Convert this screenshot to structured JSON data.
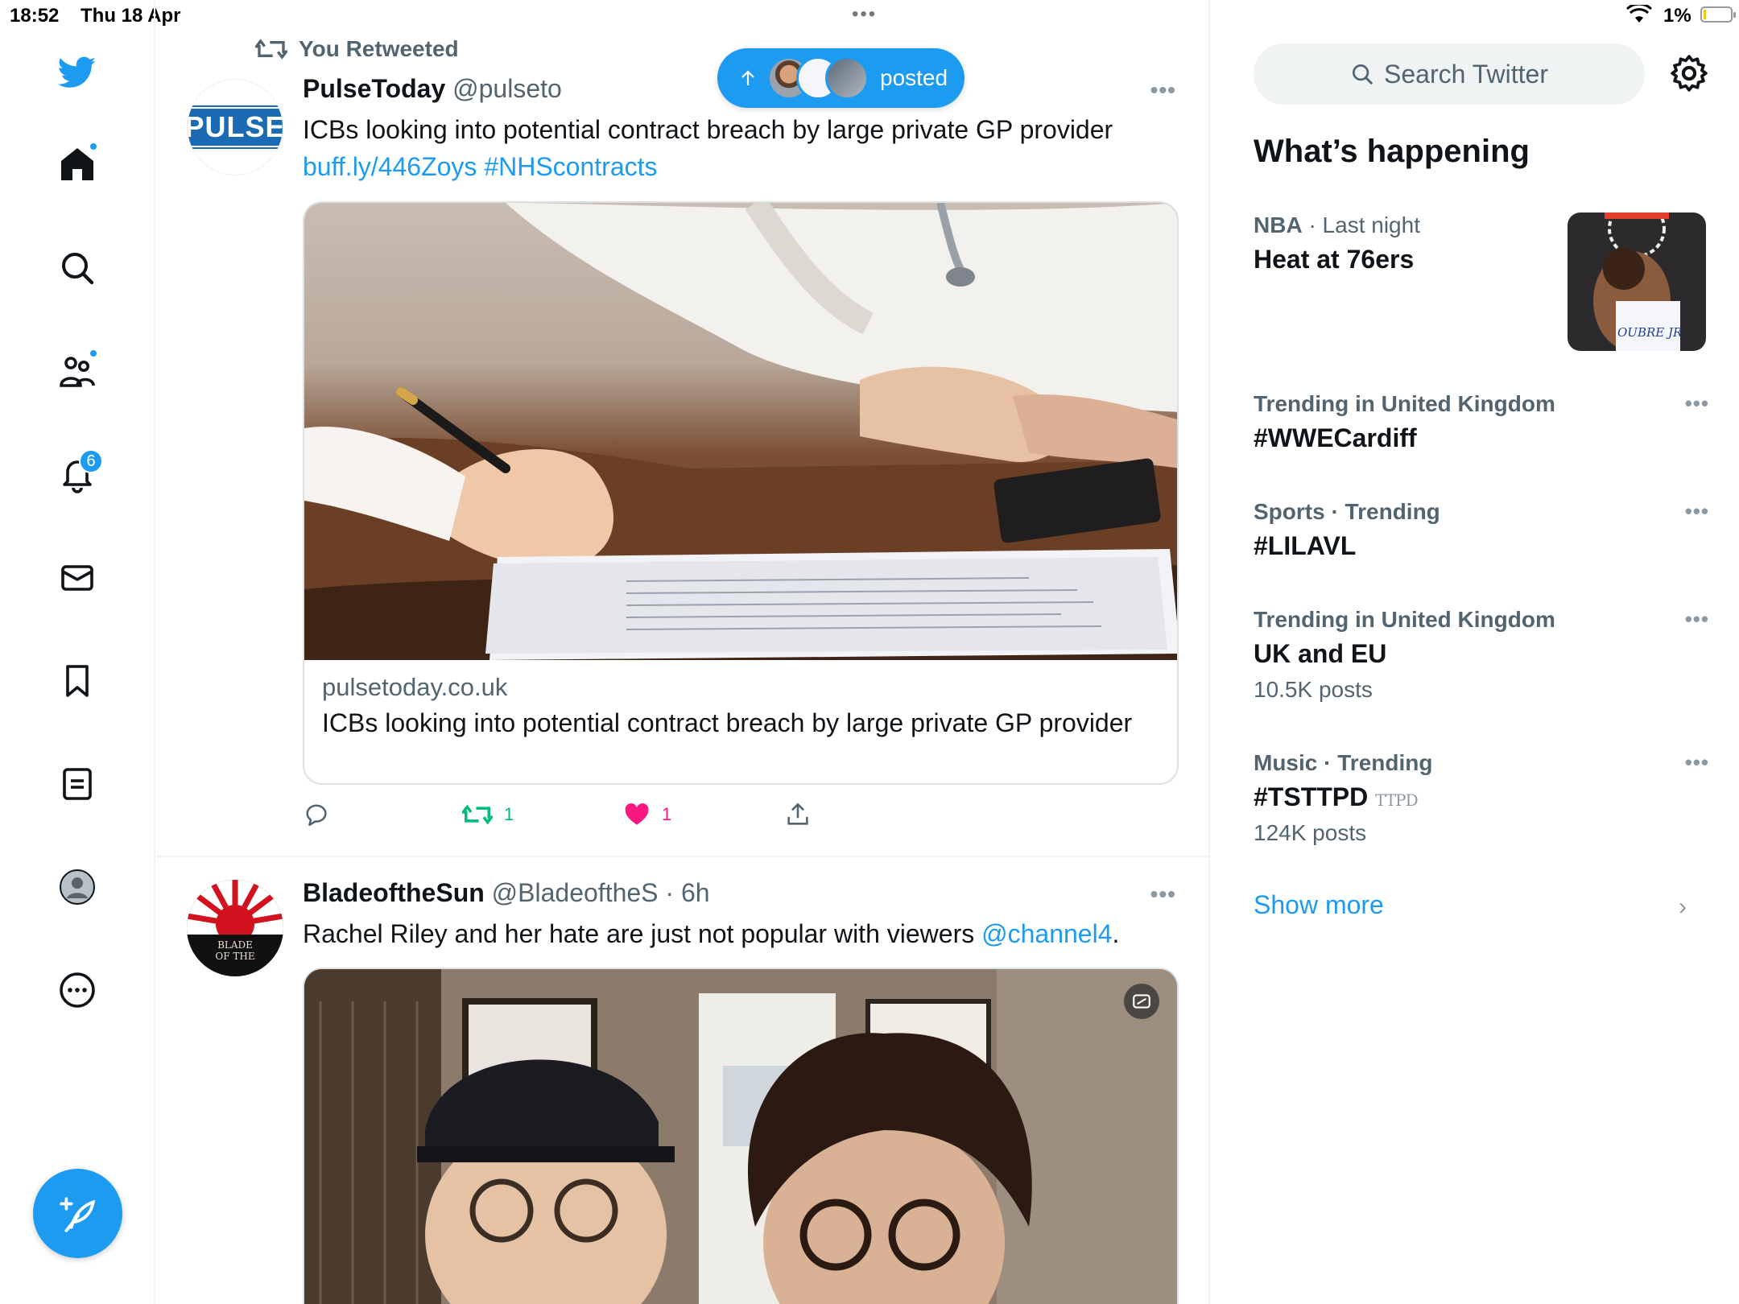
{
  "status_bar": {
    "time": "18:52",
    "date": "Thu 18 Apr",
    "multitask": "•••",
    "battery": "1%"
  },
  "nav": {
    "notifications_badge": "6"
  },
  "pill": {
    "label": "posted"
  },
  "tweets": [
    {
      "retweet_label": "You Retweeted",
      "avatar_text": "PULSE",
      "name": "PulseToday",
      "handle": "@pulseto",
      "more": "•••",
      "text": "ICBs looking into potential contract breach by large private GP provider",
      "link": "buff.ly/446Zoys",
      "hashtag": "#NHScontracts",
      "card_domain": "pulsetoday.co.uk",
      "card_title": "ICBs looking into potential contract breach by large private GP provider",
      "retweets": "1",
      "likes": "1"
    },
    {
      "avatar_text": "BLADE OF THE",
      "name": "BladeoftheSun",
      "handle": "@BladeoftheS · 6h",
      "more": "•••",
      "text": "Rachel Riley and her hate are just not popular with viewers ",
      "mention": "@channel4",
      "text_end": "."
    }
  ],
  "right": {
    "search_placeholder": "Search Twitter",
    "section_title": "What’s happening",
    "trends": [
      {
        "category": "NBA",
        "meta_rest": " · Last night",
        "title": "Heat at 76ers",
        "count": "",
        "image_text": "OUBRE JR"
      },
      {
        "category": "Trending in United Kingdom",
        "meta_rest": "",
        "title": "#WWECardiff",
        "count": ""
      },
      {
        "category": "Sports · Trending",
        "meta_rest": "",
        "title": "#LILAVL",
        "count": ""
      },
      {
        "category": "Trending in United Kingdom",
        "meta_rest": "",
        "title": "UK and EU",
        "count": "10.5K posts"
      },
      {
        "category": "Music · Trending",
        "meta_rest": "",
        "title": "#TSTTPD",
        "title_badge": "TTPD",
        "count": "124K posts"
      }
    ],
    "show_more": "Show more"
  },
  "colors": {
    "accent": "#1d9bf0",
    "retweet_green": "#00ba7c",
    "like_pink": "#f91880"
  }
}
